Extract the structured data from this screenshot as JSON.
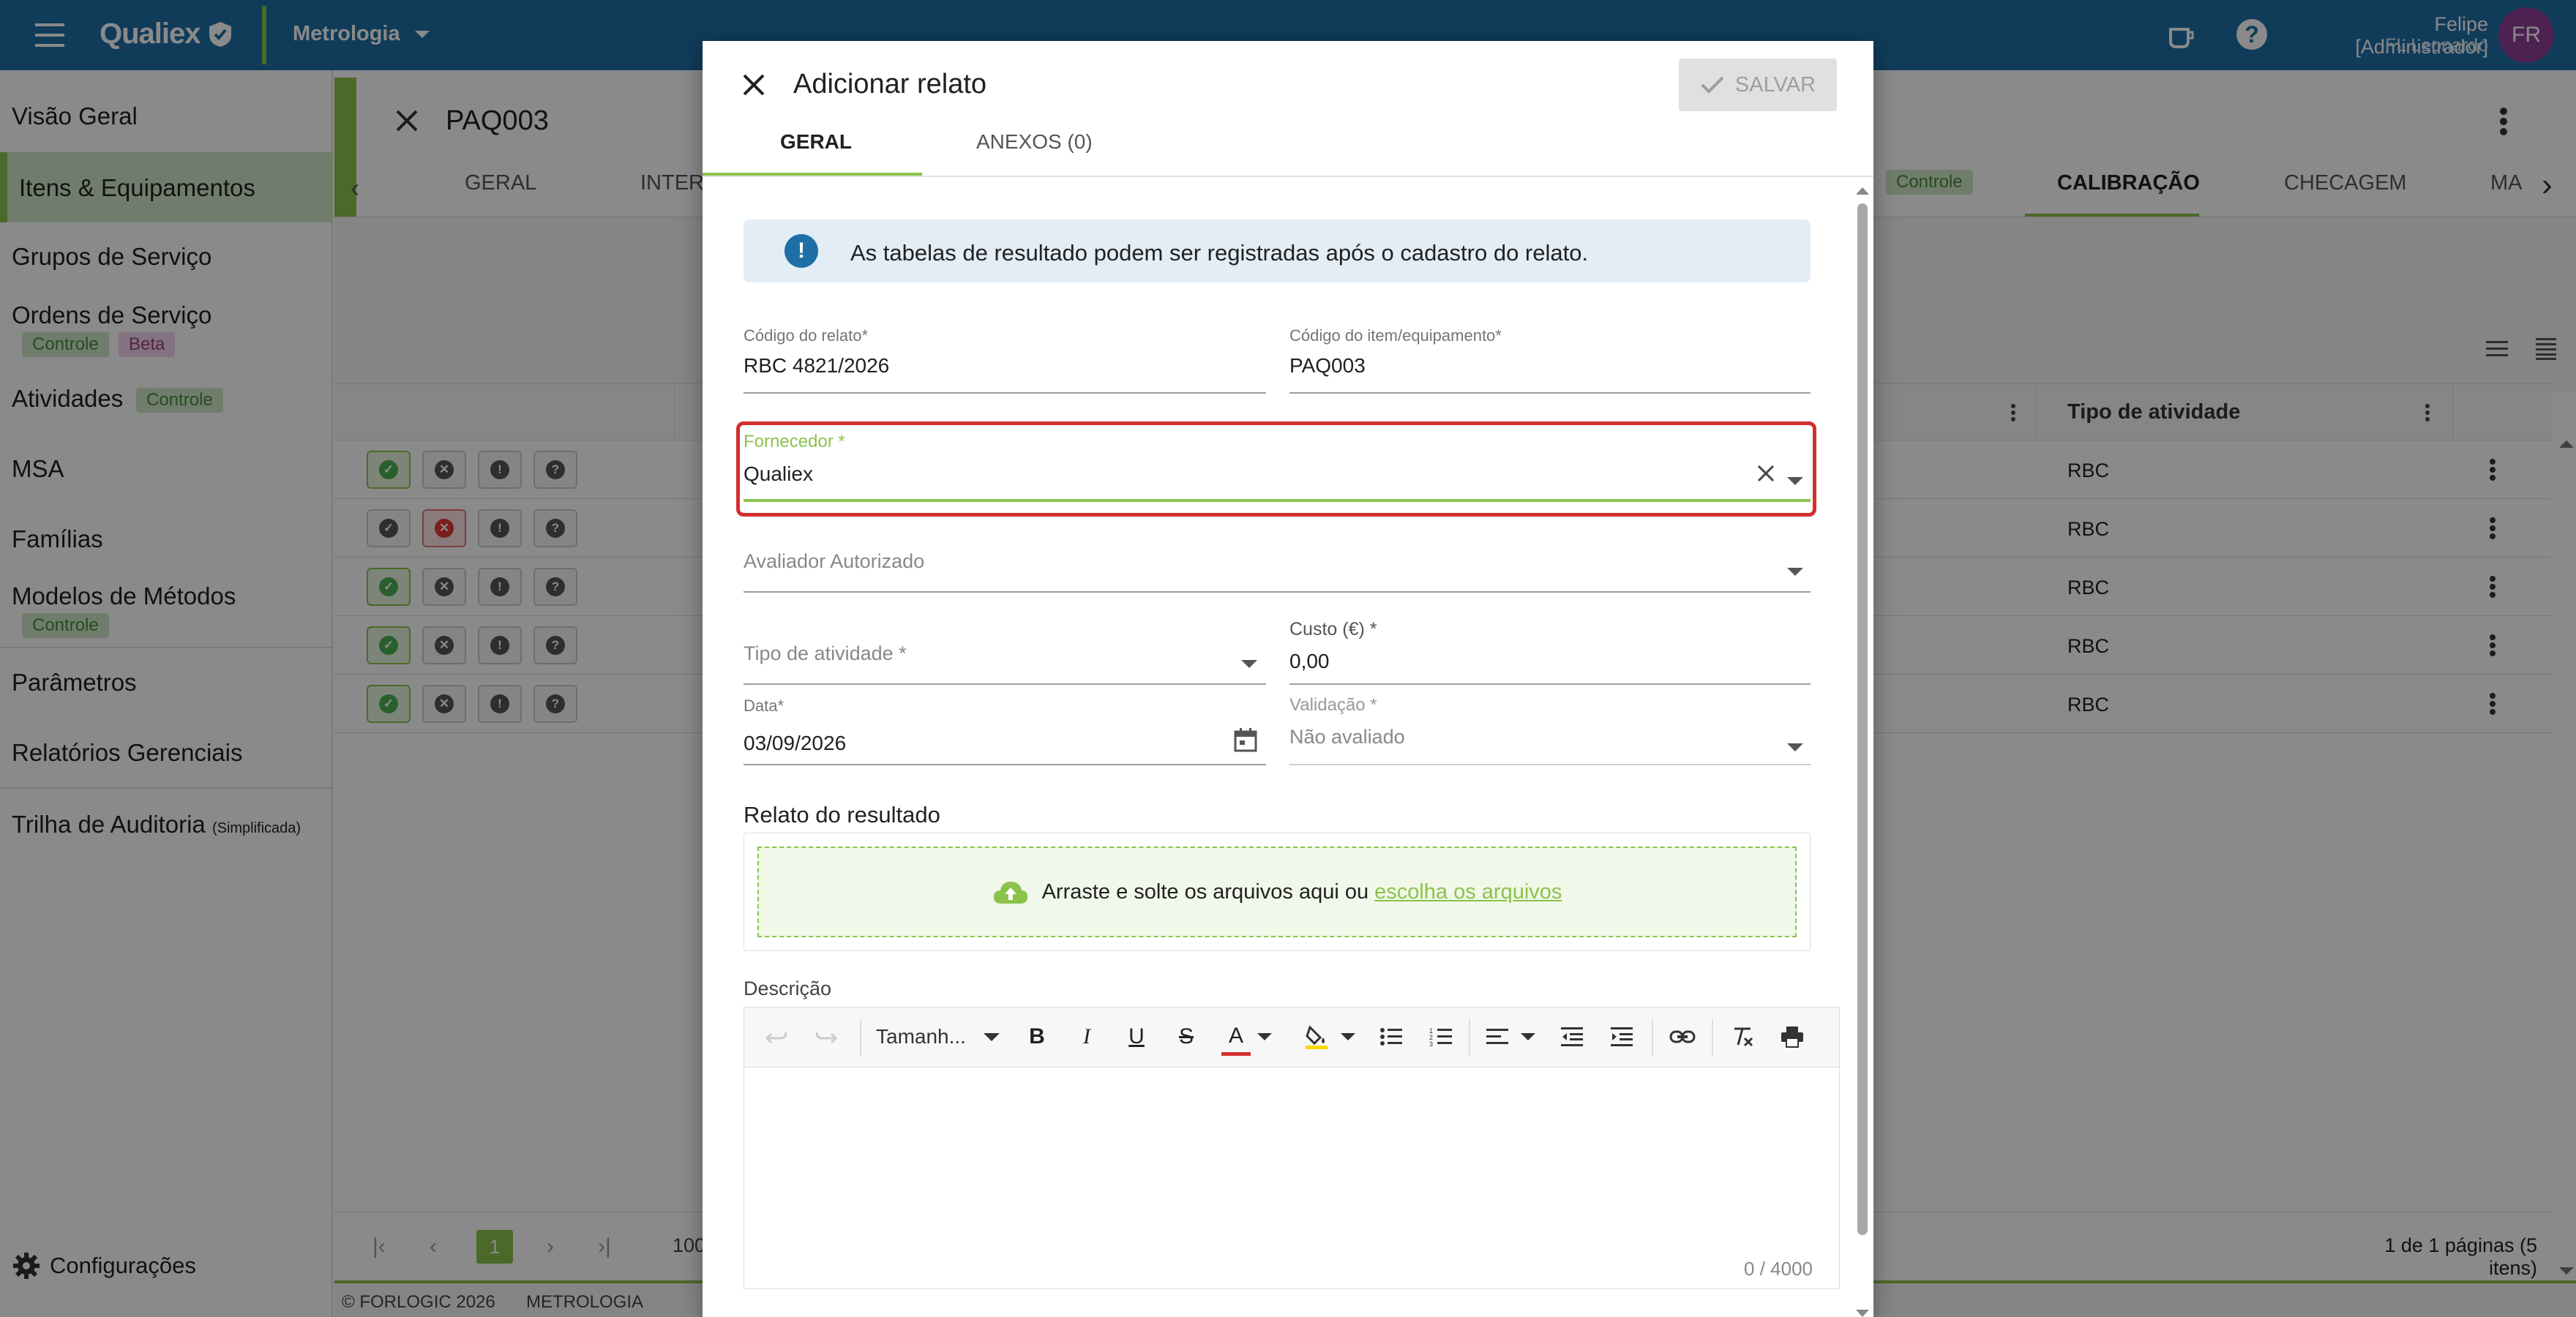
{
  "topbar": {
    "brand": "Qualiex",
    "module": "Metrologia",
    "user_name": "Felipe [Administrador]",
    "user_org": "FL Leonardo",
    "avatar_initials": "FR"
  },
  "sidebar": {
    "items": [
      {
        "label": "Visão Geral"
      },
      {
        "label": "Itens & Equipamentos"
      },
      {
        "label": "Grupos de Serviço"
      },
      {
        "label": "Ordens de Serviço",
        "chips": [
          "Controle",
          "Beta"
        ]
      },
      {
        "label": "Atividades",
        "chips": [
          "Controle"
        ]
      },
      {
        "label": "MSA"
      },
      {
        "label": "Famílias"
      },
      {
        "label": "Modelos de Métodos",
        "chips": [
          "Controle"
        ]
      },
      {
        "label": "Parâmetros"
      },
      {
        "label": "Relatórios Gerenciais"
      },
      {
        "label": "Trilha de Auditoria",
        "suffix": "(Simplificada)"
      }
    ],
    "settings_label": "Configurações"
  },
  "page": {
    "title": "PAQ003",
    "tabs": [
      "GERAL",
      "INTERV",
      "Controle",
      "CALIBRAÇÃO",
      "CHECAGEM",
      "MA"
    ],
    "active_tab": "CALIBRAÇÃO",
    "table_header_activity": "Tipo de atividade",
    "rows": [
      {
        "activity": "RBC"
      },
      {
        "activity": "RBC"
      },
      {
        "activity": "RBC"
      },
      {
        "activity": "RBC"
      },
      {
        "activity": "RBC"
      }
    ],
    "pager_current": "1",
    "page_size": "100",
    "pager_summary": "1 de 1 páginas (5 itens)",
    "footer_copyright": "© FORLOGIC 2026",
    "footer_module": "METROLOGIA"
  },
  "dialog": {
    "title": "Adicionar relato",
    "save_label": "SALVAR",
    "tabs": [
      "GERAL",
      "ANEXOS (0)"
    ],
    "info_text": "As tabelas de resultado podem ser registradas após o cadastro do relato.",
    "fields": {
      "report_code": {
        "label": "Código do relato*",
        "value": "RBC 4821/2026"
      },
      "item_code": {
        "label": "Código do item/equipamento*",
        "value": "PAQ003"
      },
      "supplier": {
        "label": "Fornecedor *",
        "value": "Qualiex"
      },
      "evaluator": {
        "label": "Avaliador Autorizado"
      },
      "activity_type": {
        "label": "Tipo de atividade *"
      },
      "cost": {
        "label": "Custo (€) *",
        "value": "0,00"
      },
      "date": {
        "label": "Data*",
        "value": "03/09/2026"
      },
      "validation": {
        "label": "Validação *",
        "value": "Não avaliado"
      }
    },
    "result_section": "Relato do resultado",
    "dropzone_text": "Arraste e solte os arquivos aqui ou",
    "dropzone_link": "escolha os arquivos",
    "description_label": "Descrição",
    "font_size_label": "Tamanh...",
    "char_count": "0 / 4000"
  },
  "colors": {
    "topbar": "#1e6fa6",
    "accent_green": "#8bc34a",
    "highlight_red": "#d32f2f",
    "avatar": "#8e3f9a"
  }
}
